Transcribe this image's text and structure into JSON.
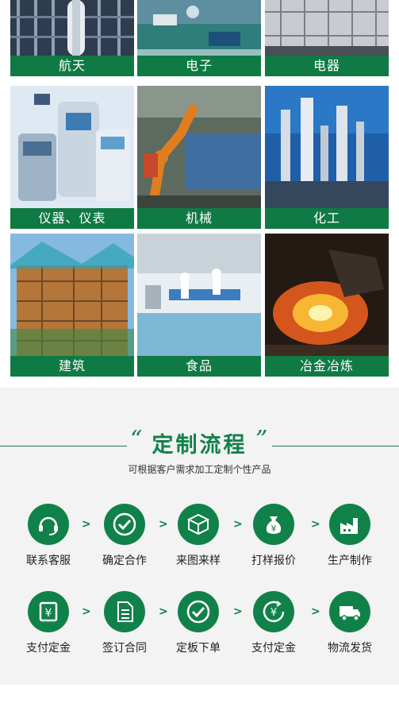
{
  "industries": [
    {
      "label": "航天",
      "icon": "aerospace-image"
    },
    {
      "label": "电子",
      "icon": "electronics-image"
    },
    {
      "label": "电器",
      "icon": "appliance-image"
    },
    {
      "label": "仪器、仪表",
      "icon": "instrument-image"
    },
    {
      "label": "机械",
      "icon": "machinery-image"
    },
    {
      "label": "化工",
      "icon": "chemical-image"
    },
    {
      "label": "建筑",
      "icon": "construction-image"
    },
    {
      "label": "食品",
      "icon": "food-image"
    },
    {
      "label": "冶金冶炼",
      "icon": "metallurgy-image"
    }
  ],
  "process": {
    "title": "定制流程",
    "subtitle": "可根据客户需求加工定制个性产品",
    "row1": [
      {
        "label": "联系客服",
        "icon": "customer-service-icon"
      },
      {
        "label": "确定合作",
        "icon": "check-circle-icon"
      },
      {
        "label": "来图来样",
        "icon": "package-icon"
      },
      {
        "label": "打样报价",
        "icon": "money-bag-icon"
      },
      {
        "label": "生产制作",
        "icon": "factory-icon"
      }
    ],
    "row2": [
      {
        "label": "支付定金",
        "icon": "yen-receipt-icon"
      },
      {
        "label": "签订合同",
        "icon": "contract-icon"
      },
      {
        "label": "定板下单",
        "icon": "check-circle-icon"
      },
      {
        "label": "支付定金",
        "icon": "yen-cycle-icon"
      },
      {
        "label": "物流发货",
        "icon": "delivery-truck-icon"
      }
    ]
  },
  "colors": {
    "brand_green": "#11814a",
    "label_green": "#0f7a44"
  }
}
